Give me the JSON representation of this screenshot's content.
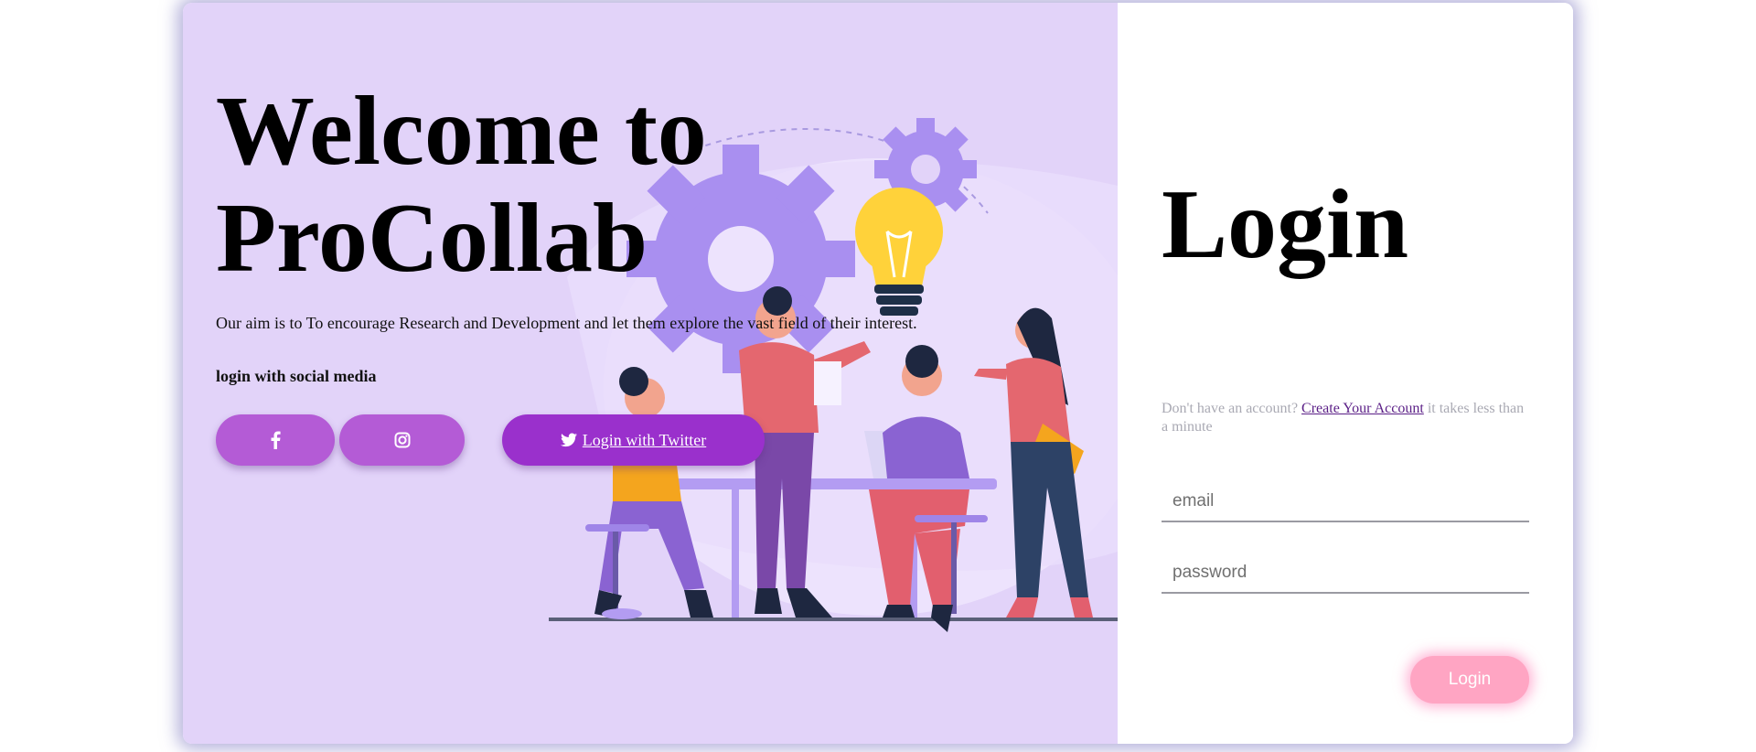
{
  "hero": {
    "title_line1": "Welcome to",
    "title_line2": "ProCollab",
    "aim": "Our aim is to To encourage Research and Development and let them explore the vast field of their interest.",
    "social_label": "login with social media"
  },
  "social": {
    "facebook_icon": "facebook-icon",
    "instagram_icon": "instagram-icon",
    "twitter_icon": "twitter-icon",
    "twitter_label": " Login with Twitter"
  },
  "login": {
    "title": "Login",
    "no_account_prefix": "Don't have an account? ",
    "create_account_link": "Create Your Account",
    "no_account_suffix": " it takes less than a minute",
    "email_placeholder": "email",
    "password_placeholder": "password",
    "submit_label": "Login"
  },
  "colors": {
    "left_background": "#e2d3f9",
    "social_button": "#b45bd6",
    "twitter_button": "#9a30cc",
    "login_button": "#ffa5c3",
    "link": "#5a1e86"
  }
}
